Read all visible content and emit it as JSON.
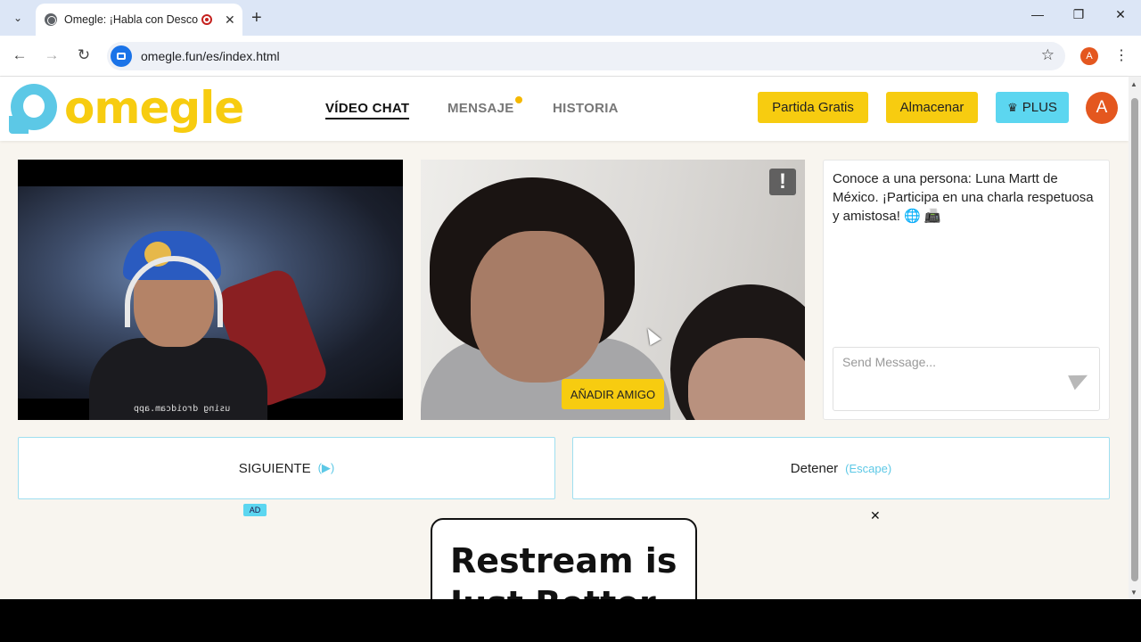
{
  "browser": {
    "tab_title": "Omegle: ¡Habla con Descon",
    "url": "omegle.fun/es/index.html",
    "profile_initial": "A",
    "new_tab_symbol": "+",
    "close_tab_symbol": "✕"
  },
  "header": {
    "logo_text": "omegle",
    "nav": [
      {
        "label": "VÍDEO CHAT",
        "active": true
      },
      {
        "label": "MENSAJE",
        "has_notification": true
      },
      {
        "label": "HISTORIA"
      }
    ],
    "buttons": {
      "free_game": "Partida Gratis",
      "store": "Almacenar",
      "plus": "PLUS"
    },
    "avatar_initial": "A",
    "colors": {
      "accent_yellow": "#f7cc10",
      "accent_cyan": "#5cd6f0",
      "avatar_orange": "#e4571f"
    }
  },
  "video": {
    "local_overlay_text": "using droidcam.app",
    "add_friend_label": "AÑADIR AMIGO",
    "report_icon": "!"
  },
  "chat": {
    "intro_message": "Conoce a una persona: Luna Martt de México. ¡Participa en una charla respetuosa y amistosa! 🌐 📠",
    "input_placeholder": "Send Message..."
  },
  "controls": {
    "next_label": "SIGUIENTE",
    "next_hint": "(▶)",
    "stop_label": "Detener",
    "stop_hint": "(Escape)"
  },
  "ad": {
    "tag": "AD",
    "close_symbol": "✕",
    "headline": "Restream is\nJust Better"
  }
}
